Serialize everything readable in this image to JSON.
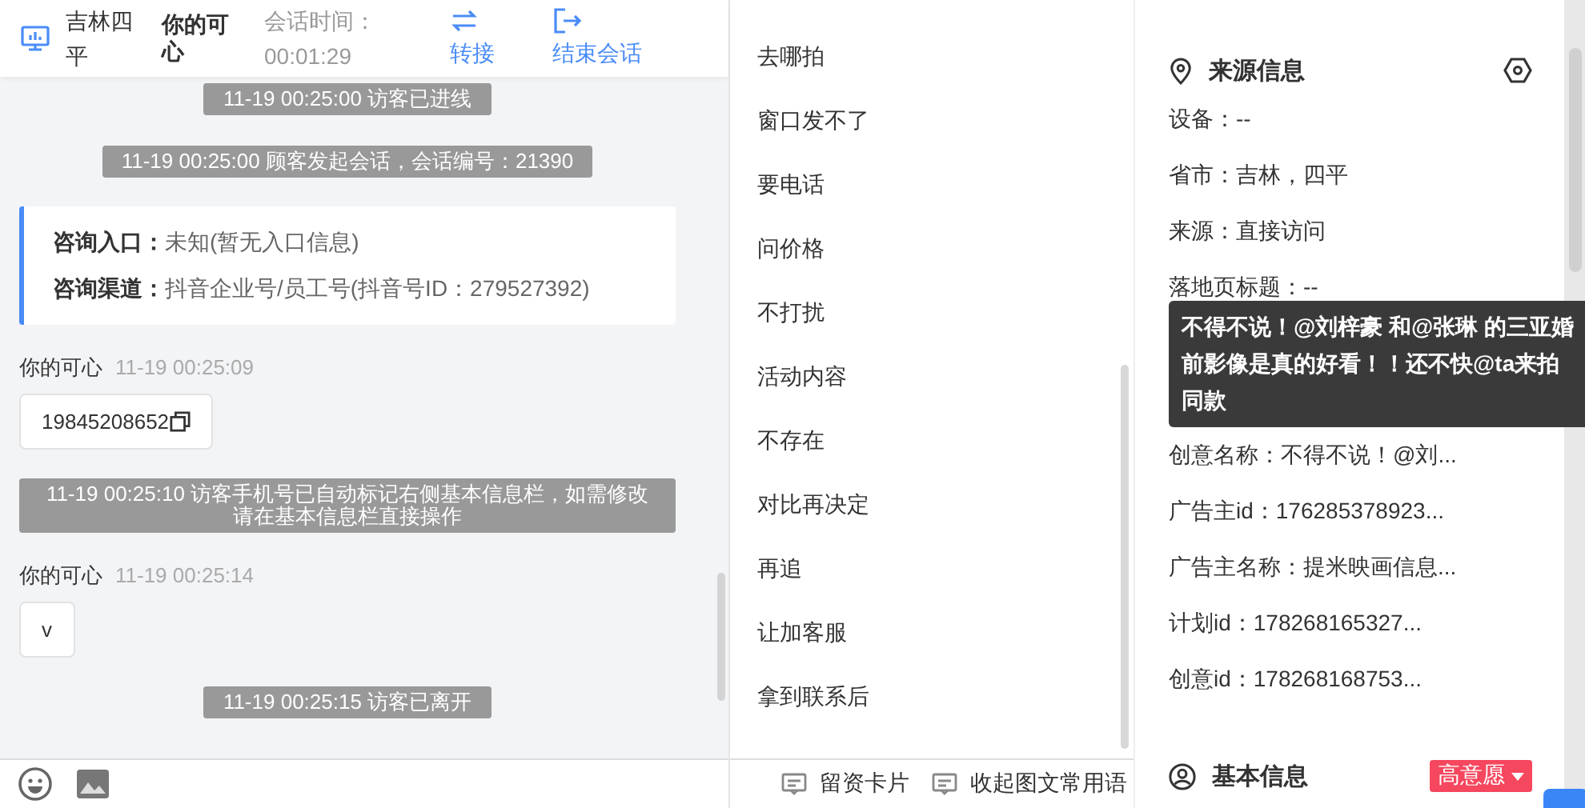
{
  "header": {
    "location": "吉林四平",
    "visitor": "你的可心",
    "timer_label": "会话时间：",
    "timer": "00:01:29",
    "actions": [
      {
        "kind": "transfer",
        "label": "转接"
      },
      {
        "kind": "end",
        "label": "结束会话"
      }
    ]
  },
  "messages": [
    {
      "kind": "system",
      "text": "11-19 00:25:00 访客已进线"
    },
    {
      "kind": "system",
      "text": "11-19 00:25:00 顾客发起会话，会话编号：21390"
    },
    {
      "kind": "card",
      "lines": [
        {
          "label": "咨询入口：",
          "value": "未知(暂无入口信息)"
        },
        {
          "label": "咨询渠道：",
          "value": "抖音企业号/员工号(抖音号ID：279527392)"
        }
      ]
    },
    {
      "kind": "message",
      "sender": "你的可心",
      "time": "11-19 00:25:09",
      "text": "19845208652",
      "copyable": true
    },
    {
      "kind": "system",
      "text": "11-19 00:25:10 访客手机号已自动标记右侧基本信息栏，如需修改请在基本信息栏直接操作"
    },
    {
      "kind": "message",
      "sender": "你的可心",
      "time": "11-19 00:25:14",
      "text": "v",
      "copyable": false
    },
    {
      "kind": "system",
      "text": "11-19 00:25:15 访客已离开"
    }
  ],
  "quick_replies": [
    "去哪拍",
    "窗口发不了",
    "要电话",
    "问价格",
    "不打扰",
    "活动内容",
    "不存在",
    "对比再决定",
    "再追",
    "让加客服",
    "拿到联系后"
  ],
  "bottom_actions": [
    "留资卡片",
    "收起图文常用语"
  ],
  "source_info": {
    "title": "来源信息",
    "rows_top": [
      "设备：--",
      "省市：吉林，四平",
      "来源：直接访问",
      "落地页标题：--"
    ],
    "rows_bottom": [
      "创意名称：不得不说！@刘...",
      "广告主id：176285378923...",
      "广告主名称：提米映画信息...",
      "计划id：178268165327...",
      "创意id：178268168753..."
    ]
  },
  "tooltip": "不得不说！@刘梓豪 和@张琳 的三亚婚前影像是真的好看！！还不快@ta来拍同款",
  "basic_info": {
    "title": "基本信息",
    "tag": "高意愿"
  }
}
